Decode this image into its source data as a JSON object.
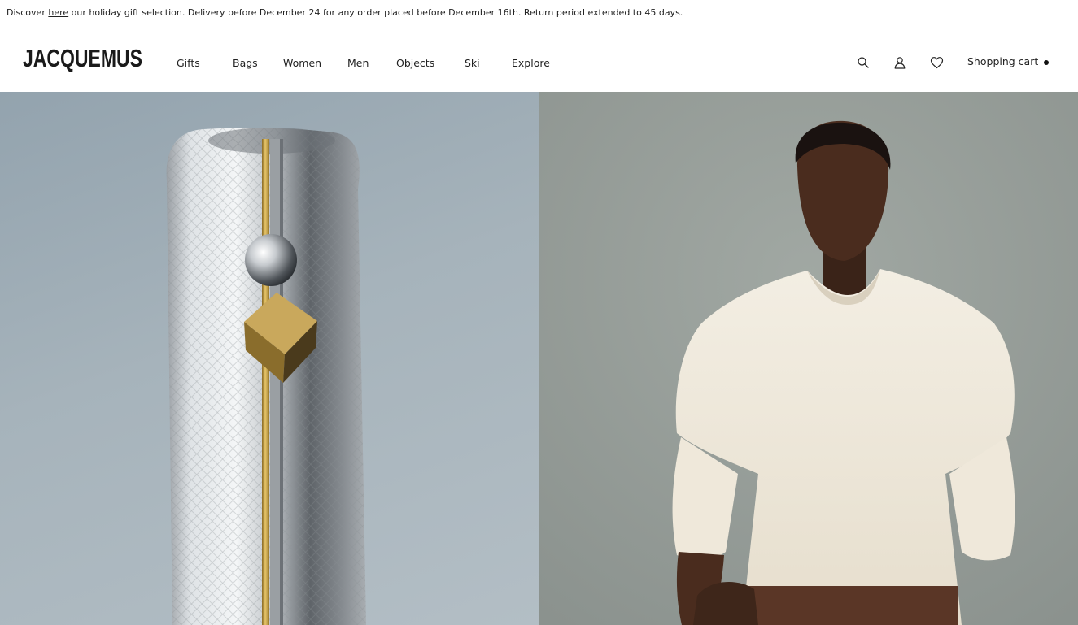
{
  "announcement": {
    "prefix": "Discover",
    "link_text": "here",
    "suffix": "our holiday gift selection. Delivery before December 24 for any order placed before December 16th. Return period extended to 45 days."
  },
  "brand": {
    "name": "JACQUEMUS"
  },
  "nav": {
    "items": [
      {
        "label": "Gifts"
      },
      {
        "label": "Bags"
      },
      {
        "label": "Women"
      },
      {
        "label": "Men"
      },
      {
        "label": "Objects"
      },
      {
        "label": "Ski"
      },
      {
        "label": "Explore"
      }
    ]
  },
  "utilities": {
    "icons": [
      "search-icon",
      "account-icon",
      "wishlist-heart-icon"
    ],
    "cart_label": "Shopping cart"
  },
  "hero": {
    "left_image": "silver-croc-bag-with-gold-clasp",
    "right_image": "model-in-cream-caped-sweater",
    "colors": {
      "left_bg": "#a2b0b9",
      "right_bg": "#979e9a",
      "sweater": "#efe9dc"
    }
  }
}
